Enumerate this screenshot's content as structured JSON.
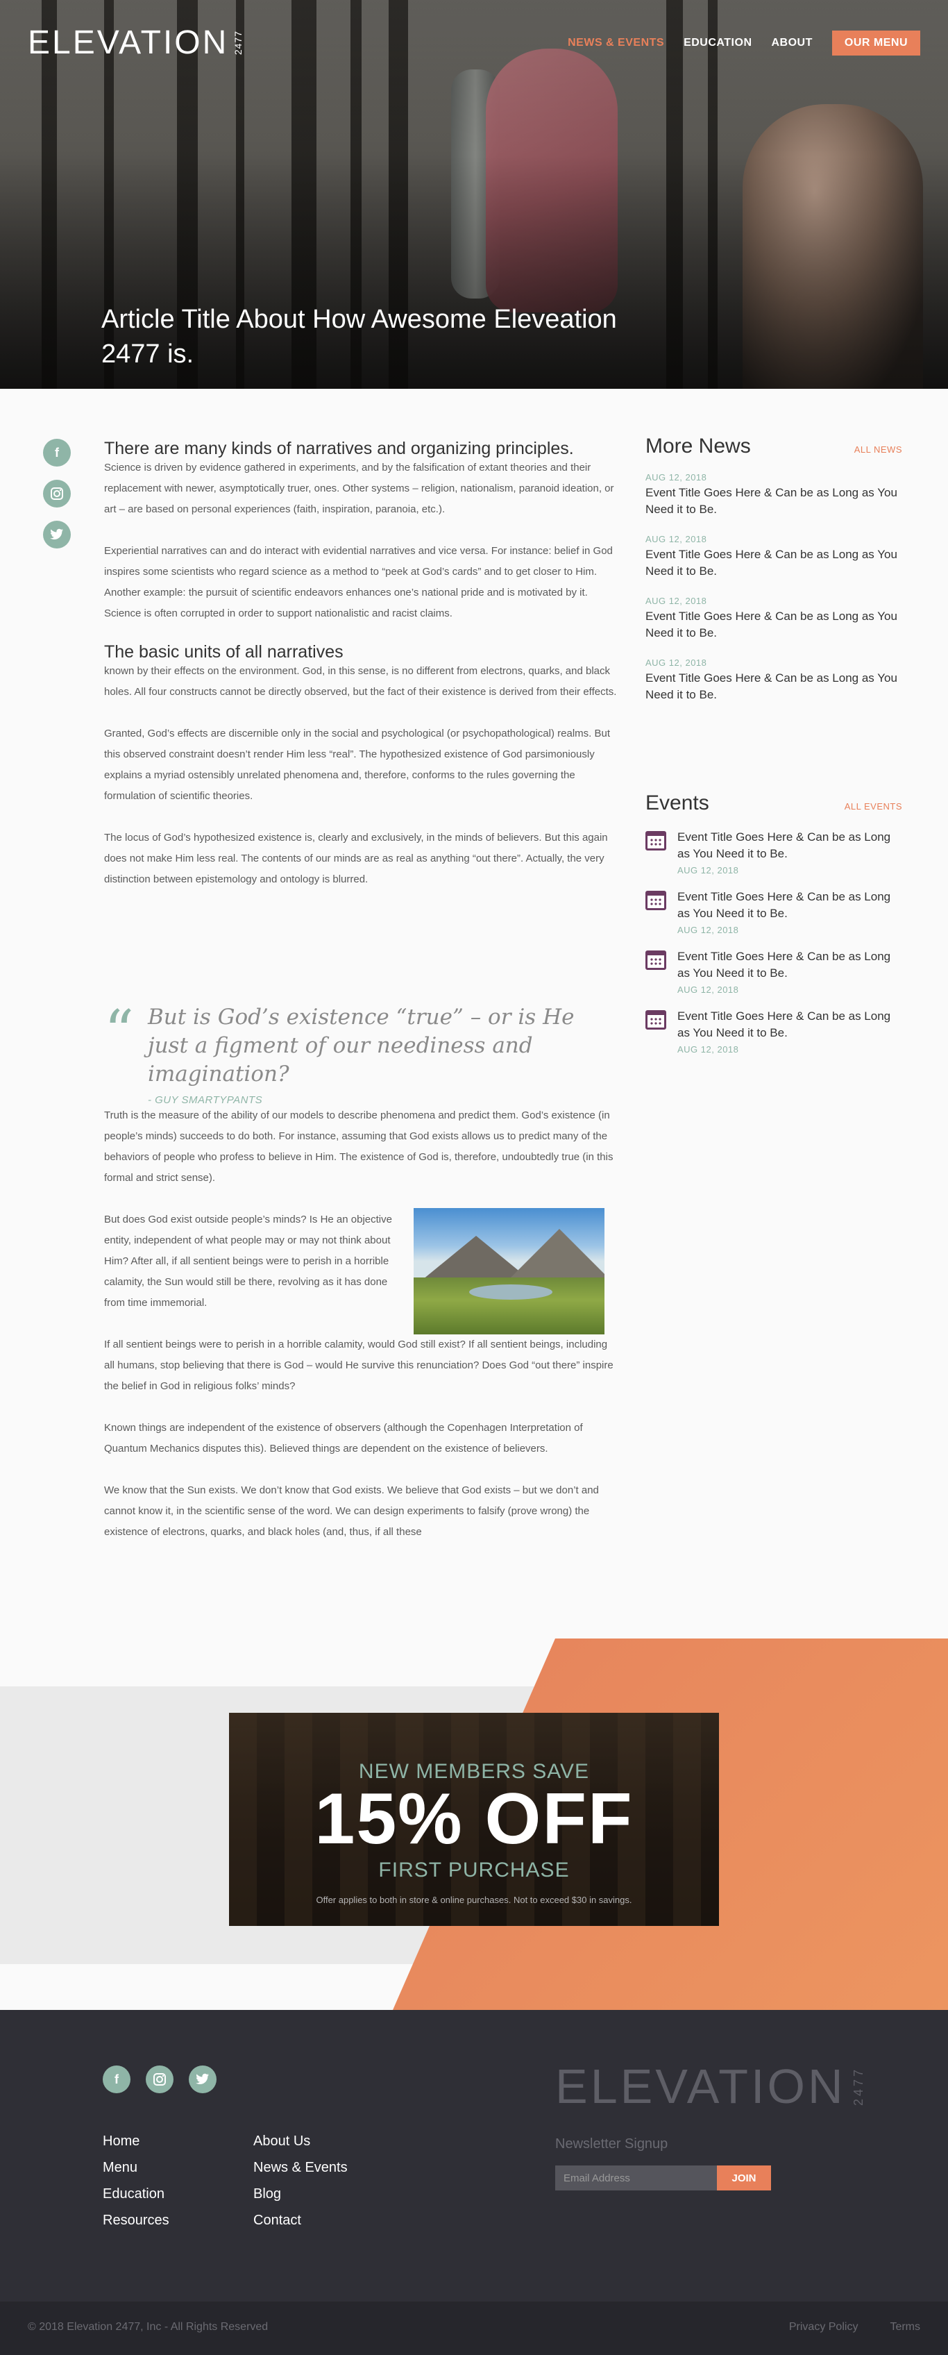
{
  "header": {
    "logo_text": "ELEVATION",
    "logo_number": "2477",
    "nav": [
      {
        "label": "NEWS & EVENTS",
        "active": true
      },
      {
        "label": "EDUCATION",
        "active": false
      },
      {
        "label": "ABOUT",
        "active": false
      }
    ],
    "menu_button": "OUR MENU"
  },
  "hero": {
    "title": "Article Title About How Awesome Eleveation 2477 is."
  },
  "social": [
    "facebook-icon",
    "instagram-icon",
    "twitter-icon"
  ],
  "article": {
    "h1": "There are many kinds of narratives and organizing principles.",
    "p1": "Science is driven by evidence gathered in experiments, and by the falsification of extant theories and their replacement with newer, asymptotically truer, ones. Other systems – religion, nationalism, paranoid ideation, or art – are based on personal experiences (faith, inspiration, paranoia, etc.).",
    "p2": "Experiential narratives can and do interact with evidential narratives and vice versa. For instance: belief in God inspires some scientists who regard science as a method to “peek at God’s cards” and to get closer to Him. Another example: the pursuit of scientific endeavors enhances one’s national pride and is motivated by it. Science is often corrupted in order to support nationalistic and racist claims.",
    "h2": "The basic units of all narratives",
    "p3": "known by their effects on the environment. God, in this sense, is no different from electrons, quarks, and black holes. All four constructs cannot be directly observed, but the fact of their existence is derived from their effects.",
    "p4": "Granted, God’s effects are discernible only in the social and psychological (or psychopathological) realms. But this observed constraint doesn’t render Him less “real”. The hypothesized existence of God parsimoniously explains a myriad ostensibly unrelated phenomena and, therefore, conforms to the rules governing the formulation of scientific theories.",
    "p5": "The locus of God’s hypothesized existence is, clearly and exclusively, in the minds of believers. But this again does not make Him less real. The contents of our minds are as real as anything “out there”. Actually, the very distinction between epistemology and ontology is blurred.",
    "quote_mark": "“",
    "quote": "But is God’s existence “true” – or is He just a figment of our neediness and imagination?",
    "quote_author": "- GUY SMARTYPANTS",
    "p6": "Truth is the measure of the ability of our models to describe phenomena and predict them. God’s existence (in people’s minds) succeeds to do both. For instance, assuming that God exists allows us to predict many of the behaviors of people who profess to believe in Him. The existence of God is, therefore, undoubtedly true (in this formal and strict sense).",
    "p7": "But does God exist outside people’s minds? Is He an objective entity, independent of what people may or may not think about Him? After all, if all sentient beings were to perish in a horrible calamity, the Sun would still be there, revolving as it has done from time immemorial.",
    "p8": "If all sentient beings were to perish in a horrible calamity, would God still exist? If all sentient beings, including all humans, stop believing that there is God – would He survive this renunciation? Does God “out there” inspire the belief in God in religious folks’ minds?",
    "p9": "Known things are independent of the existence of observers (although the Copenhagen Interpretation of Quantum Mechanics disputes this). Believed things are dependent on the existence of believers.",
    "p10": "We know that the Sun exists. We don’t know that God exists. We believe that God exists – but we don’t and cannot know it, in the scientific sense of the word. We can design experiments to falsify (prove wrong) the existence of electrons, quarks, and black holes (and, thus, if all these"
  },
  "more_news": {
    "title": "More News",
    "link": "ALL NEWS",
    "items": [
      {
        "date": "AUG 12, 2018",
        "title": "Event Title Goes Here & Can be as Long as You Need it to Be."
      },
      {
        "date": "AUG 12, 2018",
        "title": "Event Title Goes Here & Can be as Long as You Need it to Be."
      },
      {
        "date": "AUG 12, 2018",
        "title": "Event Title Goes Here & Can be as Long as You Need it to Be."
      },
      {
        "date": "AUG 12, 2018",
        "title": "Event Title Goes Here & Can be as Long as You Need it to Be."
      }
    ]
  },
  "events": {
    "title": "Events",
    "link": "ALL EVENTS",
    "items": [
      {
        "title": "Event Title Goes Here & Can be as Long as You Need it to Be.",
        "date": "AUG 12, 2018"
      },
      {
        "title": "Event Title Goes Here & Can be as Long as You Need it to Be.",
        "date": "AUG 12, 2018"
      },
      {
        "title": "Event Title Goes Here & Can be as Long as You Need it to Be.",
        "date": "AUG 12, 2018"
      },
      {
        "title": "Event Title Goes Here & Can be as Long as You Need it to Be.",
        "date": "AUG 12, 2018"
      }
    ]
  },
  "promo": {
    "line1": "NEW MEMBERS SAVE",
    "big": "15% OFF",
    "line3": "FIRST PURCHASE",
    "fine": "Offer applies to both in store & online purchases. Not to exceed $30 in savings."
  },
  "footer": {
    "col1": [
      "Home",
      "Menu",
      "Education",
      "Resources"
    ],
    "col2": [
      "About Us",
      "News & Events",
      "Blog",
      "Contact"
    ],
    "logo_text": "ELEVATION",
    "logo_number": "2477",
    "newsletter_label": "Newsletter Signup",
    "email_placeholder": "Email Address",
    "join_button": "JOIN",
    "copyright": "© 2018 Elevation 2477, Inc - All Rights Reserved",
    "legal": [
      "Privacy Policy",
      "Terms"
    ]
  },
  "colors": {
    "accent": "#e8805a",
    "teal": "#8fb5a7",
    "footer_bg": "#2f2f36",
    "calendar": "#6b3b62"
  }
}
